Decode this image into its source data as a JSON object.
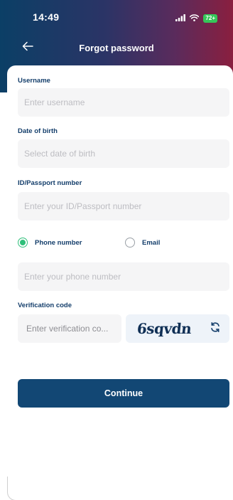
{
  "status_bar": {
    "time": "14:49",
    "battery": "72+"
  },
  "nav": {
    "title": "Forgot password"
  },
  "form": {
    "username": {
      "label": "Username",
      "placeholder": "Enter username"
    },
    "dob": {
      "label": "Date of birth",
      "placeholder": "Select date of birth"
    },
    "id_number": {
      "label": "ID/Passport number",
      "placeholder": "Enter your ID/Passport number"
    },
    "contact_method": {
      "options": [
        {
          "label": "Phone number",
          "selected": true
        },
        {
          "label": "Email",
          "selected": false
        }
      ]
    },
    "phone": {
      "placeholder": "Enter your phone number"
    },
    "verification": {
      "label": "Verification code",
      "placeholder": "Enter verification co...",
      "captcha": "6sqvdn"
    },
    "continue_label": "Continue"
  },
  "colors": {
    "primary": "#124774",
    "label": "#143e6b",
    "radio_selected": "#2fbf7a",
    "field_bg": "#f5f5f6",
    "placeholder": "#bdbdc2",
    "header_gradient": [
      "#0b3f66",
      "#2b3466",
      "#5a2b5c",
      "#8a1f3f"
    ]
  },
  "icons": {
    "back": "arrow-left-icon",
    "signal": "signal-icon",
    "wifi": "wifi-icon",
    "refresh": "refresh-icon"
  }
}
